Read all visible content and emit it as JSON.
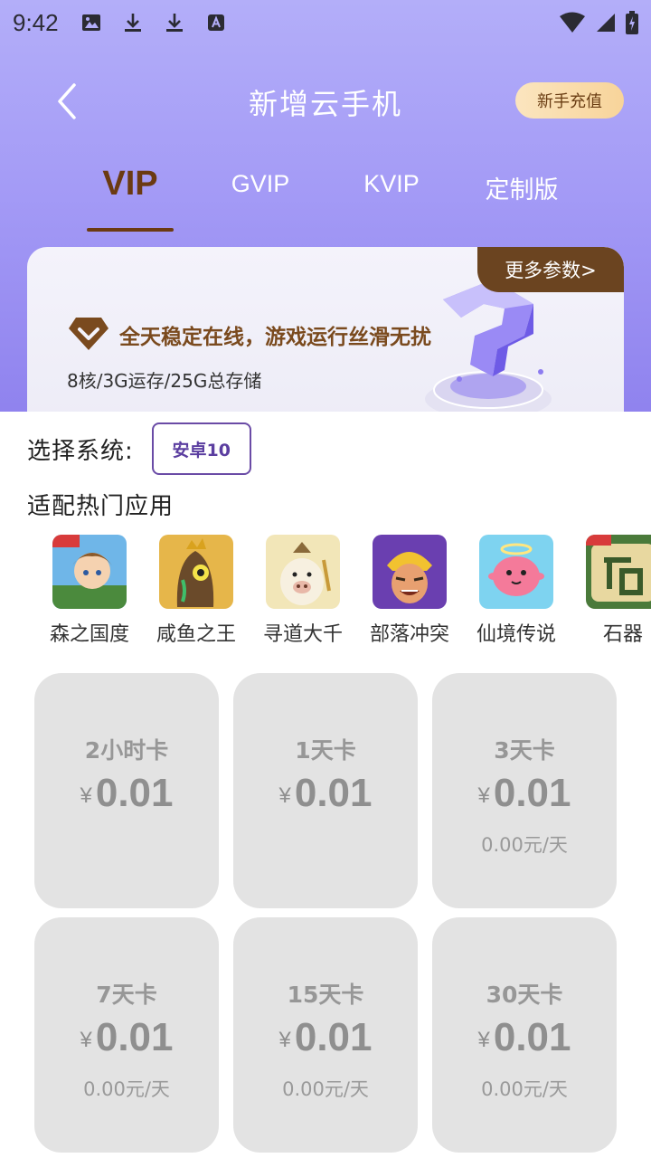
{
  "status_bar": {
    "time": "9:42"
  },
  "header": {
    "title": "新增云手机",
    "recharge_label": "新手充值"
  },
  "tabs": [
    {
      "label": "VIP",
      "active": true
    },
    {
      "label": "GVIP",
      "active": false
    },
    {
      "label": "KVIP",
      "active": false
    },
    {
      "label": "定制版",
      "active": false
    }
  ],
  "info_card": {
    "more_label": "更多参数>",
    "headline": "全天稳定在线，游戏运行丝滑无扰",
    "spec": "8核/3G运存/25G总存储"
  },
  "system": {
    "label": "选择系统:",
    "selected": "安卓10"
  },
  "apps": {
    "label": "适配热门应用",
    "items": [
      {
        "name": "森之国度",
        "icon": "forest-kingdom-icon"
      },
      {
        "name": "咸鱼之王",
        "icon": "salted-fish-king-icon"
      },
      {
        "name": "寻道大千",
        "icon": "xundao-daqian-icon"
      },
      {
        "name": "部落冲突",
        "icon": "clash-of-clans-icon"
      },
      {
        "name": "仙境传说",
        "icon": "ragnarok-icon"
      },
      {
        "name": "石器",
        "icon": "stone-age-icon"
      }
    ]
  },
  "plans": [
    {
      "title": "2小时卡",
      "currency": "¥",
      "price": "0.01",
      "daily": ""
    },
    {
      "title": "1天卡",
      "currency": "¥",
      "price": "0.01",
      "daily": ""
    },
    {
      "title": "3天卡",
      "currency": "¥",
      "price": "0.01",
      "daily": "0.00元/天"
    },
    {
      "title": "7天卡",
      "currency": "¥",
      "price": "0.01",
      "daily": "0.00元/天"
    },
    {
      "title": "15天卡",
      "currency": "¥",
      "price": "0.01",
      "daily": "0.00元/天"
    },
    {
      "title": "30天卡",
      "currency": "¥",
      "price": "0.01",
      "daily": "0.00元/天"
    }
  ],
  "colors": {
    "header_gradient_top": "#b3aef9",
    "header_gradient_bottom": "#8f82ee",
    "accent_brown": "#6b3a12",
    "system_chip_purple": "#6a4ba6",
    "plan_card_bg": "#e3e3e3"
  }
}
